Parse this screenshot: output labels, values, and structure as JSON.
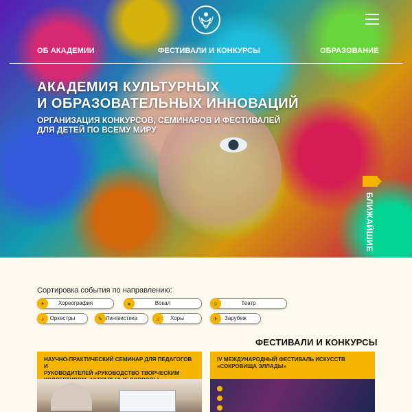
{
  "nav": {
    "about": "ОБ АКАДЕМИИ",
    "festivals": "ФЕСТИВАЛИ И КОНКУРСЫ",
    "education": "ОБРАЗОВАНИЕ"
  },
  "hero": {
    "title_line1": "АКАДЕМИЯ КУЛЬТУРНЫХ",
    "title_line2": "И ОБРАЗОВАТЕЛЬНЫХ ИННОВАЦИЙ",
    "subtitle_line1": "ОРГАНИЗАЦИЯ КОНКУРСОВ, СЕМИНАРОВ И ФЕСТИВАЛЕЙ",
    "subtitle_line2": "ДЛЯ ДЕТЕЙ ПО ВСЕМУ МИРУ",
    "nearest_label": "БЛИЖАЙШИЕ"
  },
  "filters": {
    "label": "Сортировка события по направлению:",
    "items": [
      {
        "label": "Хореография",
        "icon": "ballet-icon"
      },
      {
        "label": "Вокал",
        "icon": "microphone-icon"
      },
      {
        "label": "Театр",
        "icon": "theater-masks-icon"
      },
      {
        "label": "Оркестры",
        "icon": "music-note-icon"
      },
      {
        "label": "Лингвистика",
        "icon": "pen-icon"
      },
      {
        "label": "Хоры",
        "icon": "choir-icon"
      },
      {
        "label": "Зарубеж",
        "icon": "plane-icon"
      }
    ]
  },
  "section": {
    "title": "ФЕСТИВАЛИ И КОНКУРСЫ"
  },
  "cards": [
    {
      "line1": "НАУЧНО-ПРАКТИЧЕСКИЙ СЕМИНАР ДЛЯ ПЕДАГОГОВ И",
      "line2": "РУКОВОДИТЕЛЕЙ «РУКОВОДСТВО ТВОРЧЕСКИМ",
      "line3": "КОЛЛЕКТИВОМ. АКТУАЛЬНЫЕ ВОПРОСЫ»"
    },
    {
      "line1": "IV МЕЖДУНАРОДНЫЙ ФЕСТИВАЛЬ ИСКУССТВ",
      "line2": "«СОКРОВИЩА ЭЛЛАДЫ»",
      "line3": ""
    }
  ],
  "colors": {
    "accent": "#f5b400",
    "background": "#fdf9ec"
  }
}
